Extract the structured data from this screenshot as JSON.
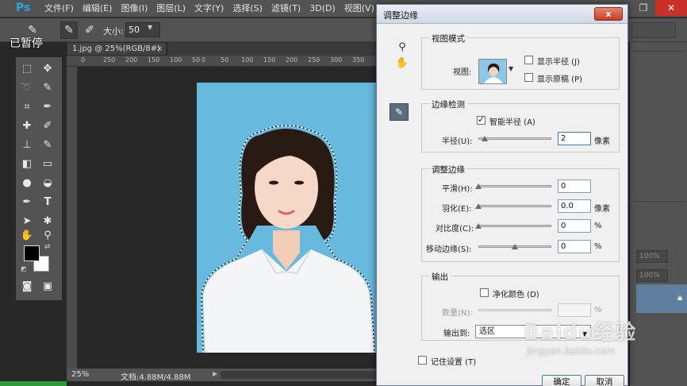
{
  "app": {
    "logo": "Ps",
    "menu": [
      "文件(F)",
      "编辑(E)",
      "图像(I)",
      "图层(L)",
      "文字(Y)",
      "选择(S)",
      "滤镜(T)",
      "3D(D)",
      "视图(V)"
    ],
    "paused_overlay": "已暂停"
  },
  "options_bar": {
    "size_label": "大小:",
    "size_value": "50"
  },
  "document": {
    "tab_title": "1.jpg @ 25%(RGB/8#)",
    "tab_close": "×",
    "ruler_ticks": [
      "0",
      "250",
      "200",
      "150",
      "100",
      "50",
      "0",
      "50",
      "100",
      "150",
      "200",
      "250",
      "300",
      "350"
    ],
    "zoom": "25%",
    "doc_info": "文档:4.88M/4.88M"
  },
  "right_panel": {
    "opacity": "100%",
    "fill": "100%"
  },
  "dialog": {
    "title": "调整边缘",
    "close_label": "x",
    "view_mode": {
      "title": "视图模式",
      "view_label": "视图:",
      "show_radius": "显示半径 (J)",
      "show_original": "显示原稿 (P)"
    },
    "edge_detection": {
      "title": "边缘检测",
      "smart_radius": "智能半径 (A)",
      "radius_label": "半径(U):",
      "radius_value": "2",
      "radius_unit": "像素"
    },
    "adjust_edge": {
      "title": "调整边缘",
      "smooth_label": "平滑(H):",
      "smooth_value": "0",
      "feather_label": "羽化(E):",
      "feather_value": "0.0",
      "feather_unit": "像素",
      "contrast_label": "对比度(C):",
      "contrast_value": "0",
      "contrast_unit": "%",
      "shift_label": "移动边缘(S):",
      "shift_value": "0",
      "shift_unit": "%"
    },
    "output": {
      "title": "输出",
      "decontaminate": "净化颜色 (D)",
      "amount_label": "数量(N):",
      "amount_unit": "%",
      "output_to_label": "输出到:",
      "output_to_value": "选区"
    },
    "remember": "记住设置 (T)",
    "ok": "确定",
    "cancel": "取消"
  },
  "watermark": {
    "brand": "Baidu经验",
    "url": "jingyan.baidu.com"
  }
}
